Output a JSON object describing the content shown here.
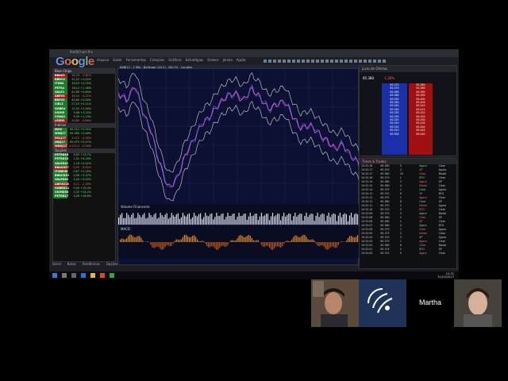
{
  "app": {
    "title": "ProfitChart Pro",
    "logo_text": [
      "G",
      "o",
      "o",
      "g",
      "l",
      "e"
    ],
    "menu": [
      "Arquivo",
      "Exibir",
      "Ferramentas",
      "Cotações",
      "Gráficos",
      "Estratégias",
      "Ordens",
      "Janela",
      "Ajuda"
    ]
  },
  "watchlist": {
    "sections": [
      {
        "name": "Blue Chips",
        "rows": [
          {
            "sym": "BBAS3",
            "price": "36,78",
            "chg": "-1,61%",
            "dir": "dn"
          },
          {
            "sym": "BBDC4",
            "price": "31,52",
            "chg": "+0,42%",
            "dir": "up"
          },
          {
            "sym": "ITUB4",
            "price": "38,10",
            "chg": "+0,25%",
            "dir": "up"
          },
          {
            "sym": "PETR4",
            "price": "16,12",
            "chg": "+1,38%",
            "dir": "up"
          },
          {
            "sym": "VALE3",
            "price": "41,80",
            "chg": "+0,80%",
            "dir": "up"
          },
          {
            "sym": "ABEV3",
            "price": "18,44",
            "chg": "-0,21%",
            "dir": "dn"
          },
          {
            "sym": "BRFS3",
            "price": "42,60",
            "chg": "+0,54%",
            "dir": "up"
          },
          {
            "sym": "CIEL3",
            "price": "27,15",
            "chg": "+0,11%",
            "dir": "up"
          },
          {
            "sym": "GGBR4",
            "price": "11,02",
            "chg": "+2,04%",
            "dir": "up"
          },
          {
            "sym": "USIM5",
            "price": "5,48",
            "chg": "+3,20%",
            "dir": "up"
          },
          {
            "sym": "CSNA3",
            "price": "9,30",
            "chg": "+1,10%",
            "dir": "up"
          },
          {
            "sym": "LREN3",
            "price": "30,80",
            "chg": "-0,64%",
            "dir": "dn"
          }
        ]
      },
      {
        "name": "Índices",
        "rows": [
          {
            "sym": "IBOV",
            "price": "65.212",
            "chg": "+0,52%",
            "dir": "up"
          },
          {
            "sym": "WINJ17",
            "price": "65.380",
            "chg": "+0,48%",
            "dir": "up"
          },
          {
            "sym": "DOLJ17",
            "price": "3.112",
            "chg": "-0,30%",
            "dir": "dn"
          },
          {
            "sym": "INDJ17",
            "price": "65.375",
            "chg": "+0,47%",
            "dir": "up"
          },
          {
            "sym": "WDOJ17",
            "price": "3.112,5",
            "chg": "-0,28%",
            "dir": "dn"
          }
        ]
      },
      {
        "name": "Opções",
        "rows": [
          {
            "sym": "PETRD16",
            "price": "0,62",
            "chg": "+12,7%",
            "dir": "up"
          },
          {
            "sym": "PETRD15",
            "price": "1,31",
            "chg": "+8,26%",
            "dir": "up"
          },
          {
            "sym": "VALED42",
            "price": "1,18",
            "chg": "+4,42%",
            "dir": "up"
          },
          {
            "sym": "BBASD37",
            "price": "0,95",
            "chg": "-9,52%",
            "dir": "dn"
          },
          {
            "sym": "ITUBD38",
            "price": "0,87",
            "chg": "+2,35%",
            "dir": "up"
          },
          {
            "sym": "BBDCD32",
            "price": "0,58",
            "chg": "+3,57%",
            "dir": "up"
          },
          {
            "sym": "VALED40",
            "price": "2,40",
            "chg": "+3,45%",
            "dir": "up"
          },
          {
            "sym": "ABEVD18",
            "price": "0,71",
            "chg": "-1,39%",
            "dir": "dn"
          },
          {
            "sym": "GGBRD11",
            "price": "0,44",
            "chg": "+10,0%",
            "dir": "up"
          },
          {
            "sym": "USIMD55",
            "price": "0,32",
            "chg": "+14,2%",
            "dir": "up"
          },
          {
            "sym": "PETRD17",
            "price": "0,28",
            "chg": "+16,6%",
            "dir": "up"
          }
        ]
      }
    ]
  },
  "bottom_tabs": [
    "Geral",
    "Bolsa",
    "Tendências",
    "Opções"
  ],
  "chart": {
    "header": "WINJ17 - 1 Min - Bollinger (20,2) - MA (9) - Candles",
    "volume_label": "Volume Financeiro",
    "indicator_label": "MACD"
  },
  "book": {
    "header": "Livro de Ofertas",
    "last_price": "65.380",
    "change": "-1,38%",
    "bids": [
      "65.375",
      "65.370",
      "65.365",
      "65.360",
      "65.355",
      "65.350",
      "65.345",
      "65.340",
      "65.335",
      "65.330",
      "65.325",
      "65.320",
      "65.315",
      "65.310",
      "65.305"
    ],
    "asks": [
      "65.380",
      "65.385",
      "65.390",
      "65.395",
      "65.400",
      "65.405",
      "65.410",
      "65.415",
      "65.420",
      "65.425",
      "65.430",
      "65.435",
      "65.440",
      "65.445",
      "65.450"
    ]
  },
  "times_trades": {
    "header": "Times & Trades",
    "rows": [
      [
        "10:32:18",
        "65.380",
        "5",
        "Ágora",
        "Clear"
      ],
      [
        "10:32:17",
        "65.375",
        "2",
        "XP",
        "Ágora"
      ],
      [
        "10:32:17",
        "65.380",
        "10",
        "Clear",
        "Modal"
      ],
      [
        "10:32:16",
        "65.375",
        "1",
        "BTG",
        "Clear"
      ],
      [
        "10:32:15",
        "65.380",
        "3",
        "Ágora",
        "XP"
      ],
      [
        "10:32:15",
        "65.380",
        "4",
        "Modal",
        "Clear"
      ],
      [
        "10:32:14",
        "65.375",
        "2",
        "Clear",
        "Ágora"
      ],
      [
        "10:32:13",
        "65.370",
        "6",
        "XP",
        "BTG"
      ],
      [
        "10:32:12",
        "65.375",
        "1",
        "Ágora",
        "Clear"
      ],
      [
        "10:32:12",
        "65.380",
        "8",
        "Clear",
        "XP"
      ],
      [
        "10:32:11",
        "65.375",
        "2",
        "Modal",
        "Ágora"
      ],
      [
        "10:32:10",
        "65.370",
        "3",
        "BTG",
        "Clear"
      ],
      [
        "10:32:09",
        "65.375",
        "5",
        "Ágora",
        "Modal"
      ],
      [
        "10:32:08",
        "65.380",
        "2",
        "Clear",
        "XP"
      ],
      [
        "10:32:08",
        "65.385",
        "1",
        "XP",
        "Clear"
      ],
      [
        "10:32:07",
        "65.380",
        "4",
        "Ágora",
        "BTG"
      ],
      [
        "10:32:06",
        "65.375",
        "7",
        "Clear",
        "Ágora"
      ],
      [
        "10:32:05",
        "65.375",
        "2",
        "Modal",
        "Clear"
      ],
      [
        "10:32:04",
        "65.370",
        "3",
        "XP",
        "Ágora"
      ],
      [
        "10:32:03",
        "65.375",
        "1",
        "Ágora",
        "Clear"
      ],
      [
        "10:32:02",
        "65.380",
        "6",
        "Clear",
        "Modal"
      ],
      [
        "10:32:01",
        "65.375",
        "2",
        "BTG",
        "XP"
      ],
      [
        "10:32:00",
        "65.370",
        "5",
        "Ágora",
        "Clear"
      ]
    ]
  },
  "clock": {
    "time": "10:32",
    "date": "31/03/2017"
  },
  "participant": {
    "name": "Martha"
  }
}
